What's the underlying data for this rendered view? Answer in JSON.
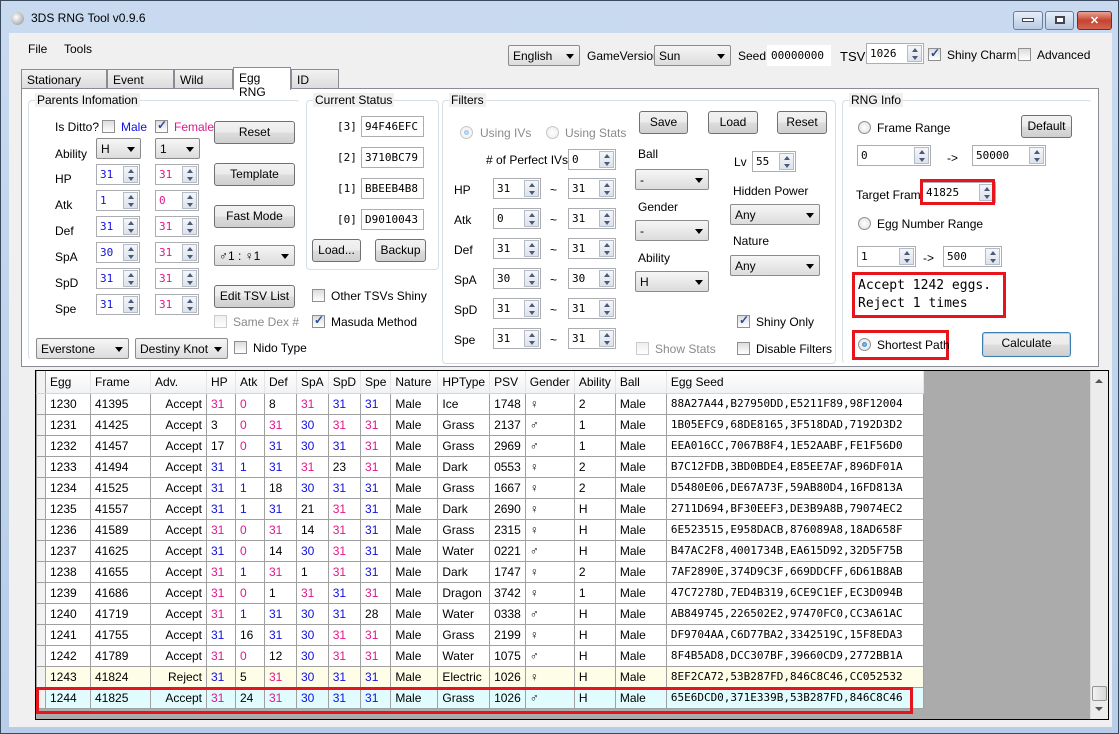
{
  "window": {
    "title": "3DS RNG Tool v0.9.6"
  },
  "menu": [
    "File",
    "Tools"
  ],
  "toolbar": {
    "language": "English",
    "game_version_label": "GameVersion",
    "game_version": "Sun",
    "seed_label": "Seed",
    "seed": "00000000",
    "tsv_label": "TSV",
    "tsv": "1026",
    "shiny_charm_label": "Shiny Charm",
    "shiny_charm": true,
    "advanced_label": "Advanced",
    "advanced": false
  },
  "tabs": [
    {
      "label": "Stationary RNG",
      "active": false
    },
    {
      "label": "Event RNG",
      "active": false
    },
    {
      "label": "Wild RNG",
      "active": false
    },
    {
      "label": "Egg RNG",
      "active": true
    },
    {
      "label": "ID RNG",
      "active": false
    }
  ],
  "parents": {
    "title": "Parents Infomation",
    "is_ditto_label": "Is Ditto?",
    "male_label": "Male",
    "male_ditto": false,
    "female_label": "Female",
    "female_ditto": true,
    "ability_label": "Ability",
    "male_ability": "H",
    "female_ability": "1",
    "stats": [
      {
        "label": "HP",
        "male": "31",
        "female": "31"
      },
      {
        "label": "Atk",
        "male": "1",
        "female": "0"
      },
      {
        "label": "Def",
        "male": "31",
        "female": "31"
      },
      {
        "label": "SpA",
        "male": "30",
        "female": "31"
      },
      {
        "label": "SpD",
        "male": "31",
        "female": "31"
      },
      {
        "label": "Spe",
        "male": "31",
        "female": "31"
      }
    ],
    "reset_label": "Reset",
    "template_label": "Template",
    "fast_mode_label": "Fast Mode",
    "gender_ratio": "♂1 : ♀1",
    "edit_tsv_label": "Edit TSV List",
    "same_dex_label": "Same Dex #",
    "male_item": "Everstone",
    "female_item": "Destiny Knot",
    "nido_type_label": "Nido Type"
  },
  "status": {
    "title": "Current Status",
    "seeds": [
      {
        "index": "[3]",
        "value": "94F46EFC"
      },
      {
        "index": "[2]",
        "value": "3710BC79"
      },
      {
        "index": "[1]",
        "value": "BBEEB4B8"
      },
      {
        "index": "[0]",
        "value": "D9010043"
      }
    ],
    "load_label": "Load...",
    "backup_label": "Backup",
    "other_tsvs_label": "Other TSVs Shiny",
    "other_tsvs": false,
    "masuda_label": "Masuda Method",
    "masuda": true
  },
  "filters": {
    "title": "Filters",
    "save_label": "Save",
    "load_label": "Load",
    "reset_label": "Reset",
    "using_ivs_label": "Using IVs",
    "using_stats_label": "Using Stats",
    "perfect_ivs_label": "# of Perfect IVs",
    "perfect_ivs": "0",
    "ranges": [
      {
        "label": "HP",
        "min": "31",
        "max": "31"
      },
      {
        "label": "Atk",
        "min": "0",
        "max": "31"
      },
      {
        "label": "Def",
        "min": "31",
        "max": "31"
      },
      {
        "label": "SpA",
        "min": "30",
        "max": "30"
      },
      {
        "label": "SpD",
        "min": "31",
        "max": "31"
      },
      {
        "label": "Spe",
        "min": "31",
        "max": "31"
      }
    ],
    "tilde": "~",
    "ball_label": "Ball",
    "ball": "-",
    "gender_label": "Gender",
    "gender": "-",
    "ability_label": "Ability",
    "ability": "H",
    "lv_label": "Lv",
    "lv": "55",
    "hidden_power_label": "Hidden Power",
    "hidden_power": "Any",
    "nature_label": "Nature",
    "nature": "Any",
    "show_stats_label": "Show Stats",
    "shiny_only_label": "Shiny Only",
    "shiny_only": true,
    "disable_filters_label": "Disable Filters",
    "disable_filters": false
  },
  "rng_info": {
    "title": "RNG Info",
    "frame_range_label": "Frame Range",
    "default_label": "Default",
    "frame_min": "0",
    "frame_max": "50000",
    "arrow": "->",
    "target_frame_label": "Target Frame",
    "target_frame": "41825",
    "egg_range_label": "Egg Number Range",
    "egg_min": "1",
    "egg_max": "500",
    "result_line1": "Accept 1242 eggs.",
    "result_line2": "Reject 1 times",
    "shortest_path_label": "Shortest Path",
    "calculate_label": "Calculate"
  },
  "table": {
    "columns": [
      "Egg",
      "Frame",
      "Adv.",
      "HP",
      "Atk",
      "Def",
      "SpA",
      "SpD",
      "Spe",
      "Nature",
      "HPType",
      "PSV",
      "Gender",
      "Ability",
      "Ball",
      "Egg Seed"
    ],
    "rows": [
      {
        "egg": "1230",
        "frame": "41395",
        "adv": "Accept",
        "ivs": [
          [
            "31",
            "pink"
          ],
          [
            "0",
            "pink"
          ],
          [
            "8",
            "black"
          ],
          [
            "31",
            "pink"
          ],
          [
            "31",
            "blue"
          ],
          [
            "31",
            "blue"
          ]
        ],
        "nature": "Male",
        "hptype": "Ice",
        "psv": "1748",
        "gender": "♀",
        "ability": "2",
        "ball": "Male",
        "seed": "88A27A44,B27950DD,E5211F89,98F12004",
        "state": "normal"
      },
      {
        "egg": "1231",
        "frame": "41425",
        "adv": "Accept",
        "ivs": [
          [
            "3",
            "black"
          ],
          [
            "0",
            "pink"
          ],
          [
            "31",
            "pink"
          ],
          [
            "30",
            "blue"
          ],
          [
            "31",
            "pink"
          ],
          [
            "31",
            "pink"
          ]
        ],
        "nature": "Male",
        "hptype": "Grass",
        "psv": "2137",
        "gender": "♂",
        "ability": "1",
        "ball": "Male",
        "seed": "1B05EFC9,68DE8165,3F518DAD,7192D3D2",
        "state": "normal"
      },
      {
        "egg": "1232",
        "frame": "41457",
        "adv": "Accept",
        "ivs": [
          [
            "17",
            "black"
          ],
          [
            "0",
            "pink"
          ],
          [
            "31",
            "blue"
          ],
          [
            "30",
            "blue"
          ],
          [
            "31",
            "blue"
          ],
          [
            "31",
            "pink"
          ]
        ],
        "nature": "Male",
        "hptype": "Grass",
        "psv": "2969",
        "gender": "♂",
        "ability": "1",
        "ball": "Male",
        "seed": "EEA016CC,7067B8F4,1E52AABF,FE1F56D0",
        "state": "normal"
      },
      {
        "egg": "1233",
        "frame": "41494",
        "adv": "Accept",
        "ivs": [
          [
            "31",
            "blue"
          ],
          [
            "1",
            "blue"
          ],
          [
            "31",
            "blue"
          ],
          [
            "31",
            "pink"
          ],
          [
            "23",
            "black"
          ],
          [
            "31",
            "pink"
          ]
        ],
        "nature": "Male",
        "hptype": "Dark",
        "psv": "0553",
        "gender": "♀",
        "ability": "2",
        "ball": "Male",
        "seed": "B7C12FDB,3BD0BDE4,E85EE7AF,896DF01A",
        "state": "normal"
      },
      {
        "egg": "1234",
        "frame": "41525",
        "adv": "Accept",
        "ivs": [
          [
            "31",
            "blue"
          ],
          [
            "1",
            "blue"
          ],
          [
            "18",
            "black"
          ],
          [
            "30",
            "blue"
          ],
          [
            "31",
            "blue"
          ],
          [
            "31",
            "blue"
          ]
        ],
        "nature": "Male",
        "hptype": "Grass",
        "psv": "1667",
        "gender": "♀",
        "ability": "2",
        "ball": "Male",
        "seed": "D5480E06,DE67A73F,59AB80D4,16FD813A",
        "state": "normal"
      },
      {
        "egg": "1235",
        "frame": "41557",
        "adv": "Accept",
        "ivs": [
          [
            "31",
            "blue"
          ],
          [
            "1",
            "blue"
          ],
          [
            "31",
            "blue"
          ],
          [
            "21",
            "black"
          ],
          [
            "31",
            "pink"
          ],
          [
            "31",
            "blue"
          ]
        ],
        "nature": "Male",
        "hptype": "Dark",
        "psv": "2690",
        "gender": "♀",
        "ability": "H",
        "ball": "Male",
        "seed": "2711D694,BF30EEF3,DE3B9A8B,79074EC2",
        "state": "normal"
      },
      {
        "egg": "1236",
        "frame": "41589",
        "adv": "Accept",
        "ivs": [
          [
            "31",
            "pink"
          ],
          [
            "0",
            "pink"
          ],
          [
            "31",
            "pink"
          ],
          [
            "14",
            "black"
          ],
          [
            "31",
            "pink"
          ],
          [
            "31",
            "blue"
          ]
        ],
        "nature": "Male",
        "hptype": "Grass",
        "psv": "2315",
        "gender": "♀",
        "ability": "H",
        "ball": "Male",
        "seed": "6E523515,E958DACB,876089A8,18AD658F",
        "state": "normal"
      },
      {
        "egg": "1237",
        "frame": "41625",
        "adv": "Accept",
        "ivs": [
          [
            "31",
            "blue"
          ],
          [
            "0",
            "pink"
          ],
          [
            "14",
            "black"
          ],
          [
            "30",
            "blue"
          ],
          [
            "31",
            "pink"
          ],
          [
            "31",
            "blue"
          ]
        ],
        "nature": "Male",
        "hptype": "Water",
        "psv": "0221",
        "gender": "♂",
        "ability": "H",
        "ball": "Male",
        "seed": "B47AC2F8,4001734B,EA615D92,32D5F75B",
        "state": "normal"
      },
      {
        "egg": "1238",
        "frame": "41655",
        "adv": "Accept",
        "ivs": [
          [
            "31",
            "pink"
          ],
          [
            "1",
            "blue"
          ],
          [
            "31",
            "pink"
          ],
          [
            "1",
            "black"
          ],
          [
            "31",
            "pink"
          ],
          [
            "31",
            "blue"
          ]
        ],
        "nature": "Male",
        "hptype": "Dark",
        "psv": "1747",
        "gender": "♀",
        "ability": "2",
        "ball": "Male",
        "seed": "7AF2890E,374D9C3F,669DDCFF,6D61B8AB",
        "state": "normal"
      },
      {
        "egg": "1239",
        "frame": "41686",
        "adv": "Accept",
        "ivs": [
          [
            "31",
            "pink"
          ],
          [
            "0",
            "pink"
          ],
          [
            "1",
            "black"
          ],
          [
            "31",
            "pink"
          ],
          [
            "31",
            "blue"
          ],
          [
            "31",
            "pink"
          ]
        ],
        "nature": "Male",
        "hptype": "Dragon",
        "psv": "3742",
        "gender": "♀",
        "ability": "1",
        "ball": "Male",
        "seed": "47C7278D,7ED4B319,6CE9C1EF,EC3D094B",
        "state": "normal"
      },
      {
        "egg": "1240",
        "frame": "41719",
        "adv": "Accept",
        "ivs": [
          [
            "31",
            "pink"
          ],
          [
            "1",
            "blue"
          ],
          [
            "31",
            "blue"
          ],
          [
            "30",
            "blue"
          ],
          [
            "31",
            "blue"
          ],
          [
            "28",
            "black"
          ]
        ],
        "nature": "Male",
        "hptype": "Water",
        "psv": "0338",
        "gender": "♂",
        "ability": "H",
        "ball": "Male",
        "seed": "AB849745,226502E2,97470FC0,CC3A61AC",
        "state": "normal"
      },
      {
        "egg": "1241",
        "frame": "41755",
        "adv": "Accept",
        "ivs": [
          [
            "31",
            "blue"
          ],
          [
            "16",
            "black"
          ],
          [
            "31",
            "blue"
          ],
          [
            "30",
            "blue"
          ],
          [
            "31",
            "pink"
          ],
          [
            "31",
            "pink"
          ]
        ],
        "nature": "Male",
        "hptype": "Grass",
        "psv": "2199",
        "gender": "♀",
        "ability": "H",
        "ball": "Male",
        "seed": "DF9704AA,C6D77BA2,3342519C,15F8EDA3",
        "state": "normal"
      },
      {
        "egg": "1242",
        "frame": "41789",
        "adv": "Accept",
        "ivs": [
          [
            "31",
            "pink"
          ],
          [
            "0",
            "pink"
          ],
          [
            "12",
            "black"
          ],
          [
            "30",
            "blue"
          ],
          [
            "31",
            "pink"
          ],
          [
            "31",
            "pink"
          ]
        ],
        "nature": "Male",
        "hptype": "Water",
        "psv": "1075",
        "gender": "♂",
        "ability": "H",
        "ball": "Male",
        "seed": "8F4B5AD8,DCC307BF,39660CD9,2772BB1A",
        "state": "normal"
      },
      {
        "egg": "1243",
        "frame": "41824",
        "adv": "Reject",
        "ivs": [
          [
            "31",
            "blue"
          ],
          [
            "5",
            "black"
          ],
          [
            "31",
            "pink"
          ],
          [
            "30",
            "blue"
          ],
          [
            "31",
            "blue"
          ],
          [
            "31",
            "blue"
          ]
        ],
        "nature": "Male",
        "hptype": "Electric",
        "psv": "1026",
        "gender": "♀",
        "ability": "H",
        "ball": "Male",
        "seed": "8EF2CA72,53B287FD,846C8C46,CC052532",
        "state": "reject"
      },
      {
        "egg": "1244",
        "frame": "41825",
        "adv": "Accept",
        "ivs": [
          [
            "31",
            "pink"
          ],
          [
            "24",
            "black"
          ],
          [
            "31",
            "pink"
          ],
          [
            "30",
            "blue"
          ],
          [
            "31",
            "blue"
          ],
          [
            "31",
            "blue"
          ]
        ],
        "nature": "Male",
        "hptype": "Grass",
        "psv": "1026",
        "gender": "♂",
        "ability": "H",
        "ball": "Male",
        "seed": "65E6DCD0,371E339B,53B287FD,846C8C46",
        "state": "selected"
      }
    ]
  }
}
